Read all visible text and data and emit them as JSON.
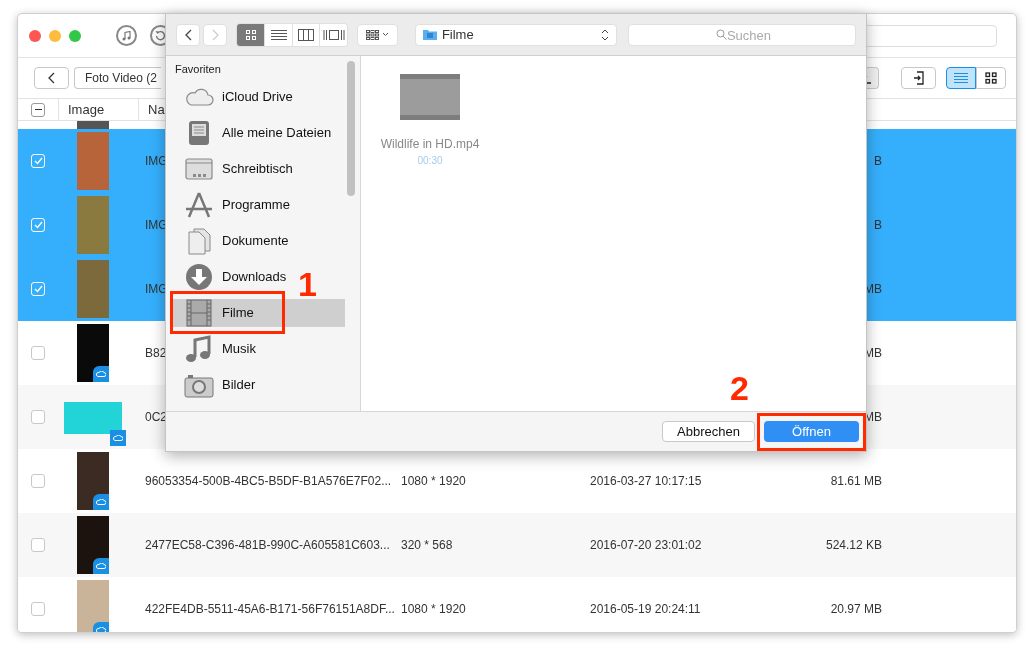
{
  "app": {
    "toolbar": {
      "breadcrumb": "Foto Video (2",
      "view_toggle": [
        {
          "kind": "list",
          "selected": true
        },
        {
          "kind": "grid",
          "selected": false
        }
      ]
    },
    "table": {
      "header_checkbox": {
        "mixed": true
      },
      "columns": [
        "Image",
        "Na"
      ],
      "rows": [
        {
          "selected": true,
          "checked": true,
          "kind": "portrait",
          "cloud": false,
          "name": "IMG",
          "size": "B"
        },
        {
          "selected": true,
          "checked": true,
          "kind": "portrait",
          "cloud": false,
          "name": "IMG",
          "size": "B"
        },
        {
          "selected": true,
          "checked": true,
          "kind": "portrait",
          "cloud": false,
          "name": "IMG",
          "size": "MB"
        },
        {
          "selected": false,
          "checked": false,
          "kind": "portrait",
          "cloud": true,
          "name": "B82",
          "size": "MB"
        },
        {
          "selected": false,
          "checked": false,
          "kind": "landscape",
          "cloud": true,
          "name": "0C2",
          "size": "MB"
        },
        {
          "selected": false,
          "checked": false,
          "kind": "portrait",
          "cloud": true,
          "name": "96053354-500B-4BC5-B5DF-B1A576E7F02...",
          "resolution": "1080 * 1920",
          "date": "2016-03-27 10:17:15",
          "size": "81.61 MB"
        },
        {
          "selected": false,
          "checked": false,
          "kind": "portrait",
          "cloud": true,
          "name": "2477EC58-C396-481B-990C-A605581C603...",
          "resolution": "320 * 568",
          "date": "2016-07-20 23:01:02",
          "size": "524.12 KB"
        },
        {
          "selected": false,
          "checked": false,
          "kind": "portrait",
          "cloud": true,
          "name": "422FE4DB-5511-45A6-B171-56F76151A8DF...",
          "resolution": "1080 * 1920",
          "date": "2016-05-19 20:24:11",
          "size": "20.97 MB"
        }
      ]
    }
  },
  "dialog": {
    "toolbar": {
      "view_modes": [
        {
          "kind": "icons",
          "selected": true
        },
        {
          "kind": "list",
          "selected": false
        },
        {
          "kind": "columns",
          "selected": false
        },
        {
          "kind": "coverflow",
          "selected": false
        }
      ],
      "location": "Filme",
      "search": {
        "placeholder": "Suchen"
      }
    },
    "sidebar": {
      "heading": "Favoriten",
      "items": [
        {
          "kind": "cloud",
          "label": "iCloud Drive",
          "selected": false
        },
        {
          "kind": "files",
          "label": "Alle meine Dateien",
          "selected": false
        },
        {
          "kind": "desktop",
          "label": "Schreibtisch",
          "selected": false
        },
        {
          "kind": "apps",
          "label": "Programme",
          "selected": false
        },
        {
          "kind": "documents",
          "label": "Dokumente",
          "selected": false
        },
        {
          "kind": "downloads",
          "label": "Downloads",
          "selected": false
        },
        {
          "kind": "movies",
          "label": "Filme",
          "selected": true
        },
        {
          "kind": "music",
          "label": "Musik",
          "selected": false
        },
        {
          "kind": "pictures",
          "label": "Bilder",
          "selected": false
        }
      ]
    },
    "files": [
      {
        "name": "Wildlife in HD.mp4",
        "duration": "00:30"
      }
    ],
    "buttons": {
      "cancel": "Abbrechen",
      "open": "Öffnen"
    }
  },
  "annotations": [
    {
      "label": "1"
    },
    {
      "label": "2"
    }
  ]
}
